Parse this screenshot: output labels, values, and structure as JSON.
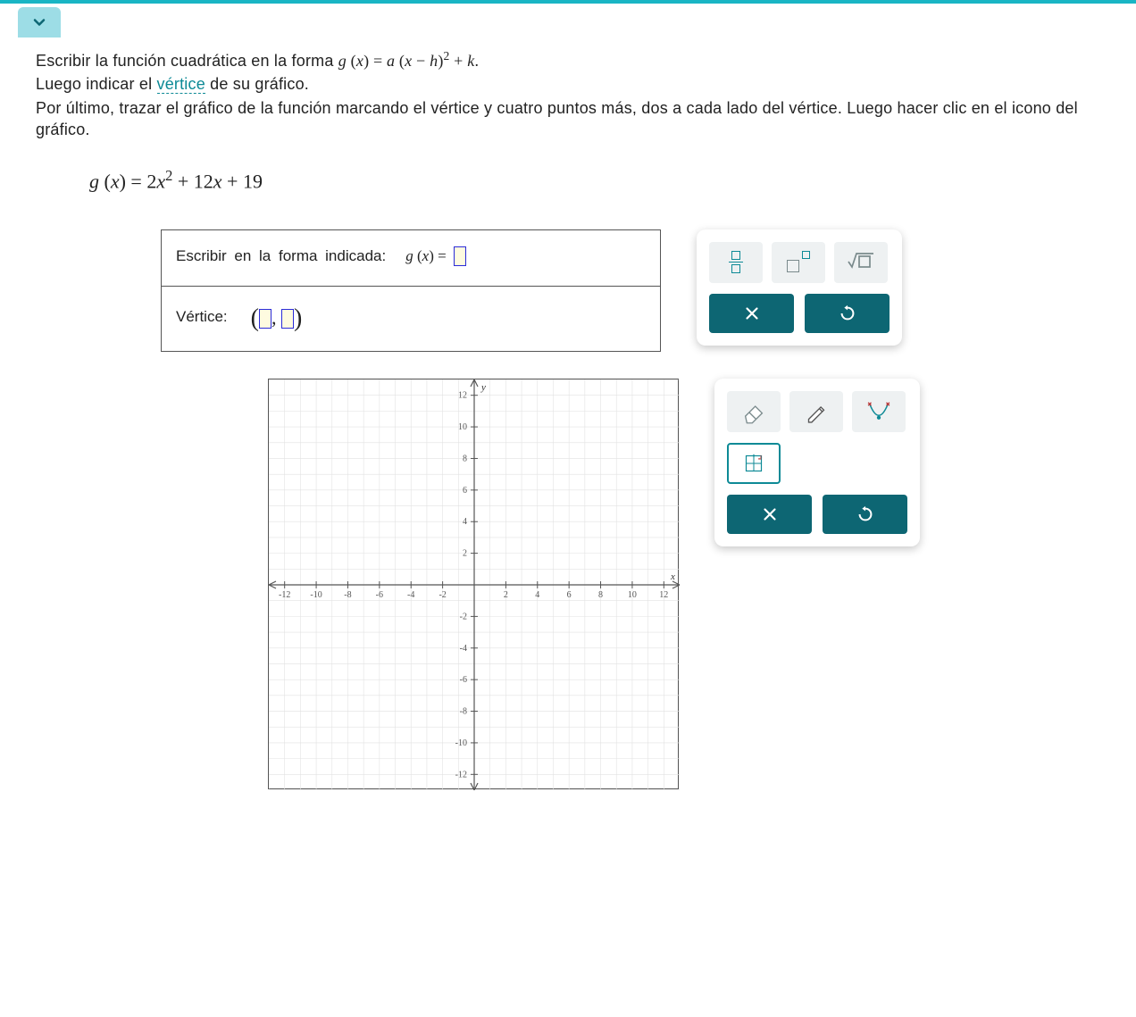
{
  "prompt": {
    "line1_pre": "Escribir la función cuadrática en la forma ",
    "formula_tex": "g(x) = a(x − h)² + k.",
    "line2_pre": "Luego indicar el ",
    "vertex_link": "vértice",
    "line2_post": " de su gráfico.",
    "line3": "Por último, trazar el gráfico de la función marcando el vértice y cuatro puntos más, dos a cada lado del vértice. Luego hacer clic en el icono del gráfico."
  },
  "given_equation": "g(x) = 2x² + 12x + 19",
  "form_box": {
    "write_label": "Escribir  en  la  forma  indicada:",
    "gx_prefix": "g (x) =",
    "vertex_label": "Vértice:"
  },
  "math_tools": {
    "fraction": "fraction",
    "exponent": "exponent",
    "sqrt": "square-root",
    "clear": "clear",
    "undo": "undo"
  },
  "graph_tools": {
    "eraser": "eraser",
    "pencil": "pencil",
    "curve": "parabola-tool",
    "grid": "fit-graph",
    "clear": "clear",
    "undo": "undo"
  },
  "chart_data": {
    "type": "scatter",
    "title": "",
    "xlabel": "x",
    "ylabel": "y",
    "xlim": [
      -13,
      13
    ],
    "ylim": [
      -13,
      13
    ],
    "xticks": [
      -12,
      -10,
      -8,
      -6,
      -4,
      -2,
      2,
      4,
      6,
      8,
      10,
      12
    ],
    "yticks": [
      -12,
      -10,
      -8,
      -6,
      -4,
      -2,
      2,
      4,
      6,
      8,
      10,
      12
    ],
    "grid": true,
    "series": []
  }
}
